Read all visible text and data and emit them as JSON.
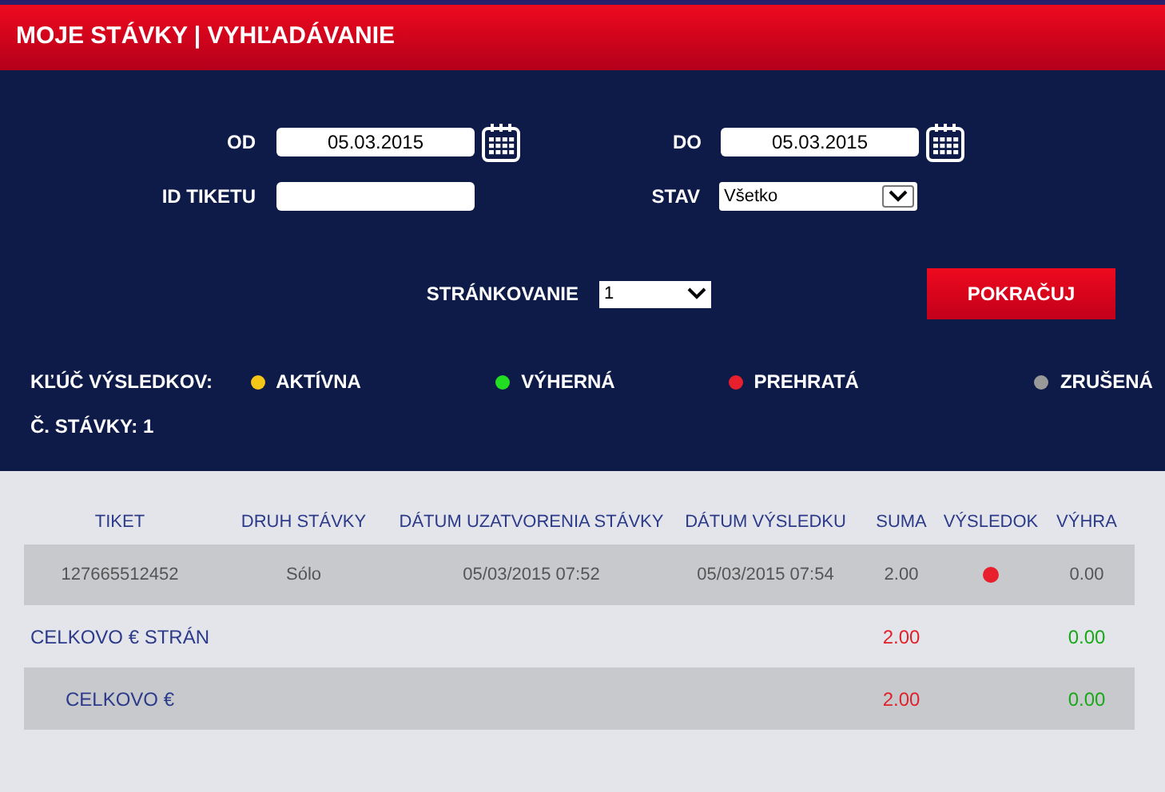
{
  "title": "MOJE STÁVKY | VYHĽADÁVANIE",
  "filters": {
    "od": {
      "label": "OD",
      "value": "05.03.2015"
    },
    "do": {
      "label": "DO",
      "value": "05.03.2015"
    },
    "ticket": {
      "label": "ID TIKETU"
    },
    "stav": {
      "label": "STAV",
      "value": "Všetko"
    }
  },
  "paging": {
    "label": "STRÁNKOVANIE",
    "value": "1"
  },
  "submit": "POKRAČUJ",
  "legend": {
    "label": "KĽÚČ VÝSLEDKOV:",
    "items": [
      {
        "label": "AKTÍVNA",
        "color": "#f5c518"
      },
      {
        "label": "VÝHERNÁ",
        "color": "#22dd22"
      },
      {
        "label": "PREHRATÁ",
        "color": "#e8202e"
      },
      {
        "label": "ZRUŠENÁ",
        "color": "#999999"
      }
    ]
  },
  "bet_count": "Č. STÁVKY: 1",
  "table": {
    "columns": [
      "TIKET",
      "DRUH STÁVKY",
      "DÁTUM UZATVORENIA STÁVKY",
      "DÁTUM VÝSLEDKU",
      "SUMA",
      "VÝSLEDOK",
      "VÝHRA"
    ],
    "rows": [
      {
        "ticket": "127665512452",
        "type": "Sólo",
        "closed": "05/03/2015 07:52",
        "result_date": "05/03/2015 07:54",
        "amount": "2.00",
        "color": "#e8202e",
        "win": "0.00"
      }
    ],
    "totals": [
      {
        "label": "CELKOVO € STRÁN",
        "amount": "2.00",
        "win": "0.00"
      },
      {
        "label": "CELKOVO €",
        "amount": "2.00",
        "win": "0.00"
      }
    ]
  }
}
